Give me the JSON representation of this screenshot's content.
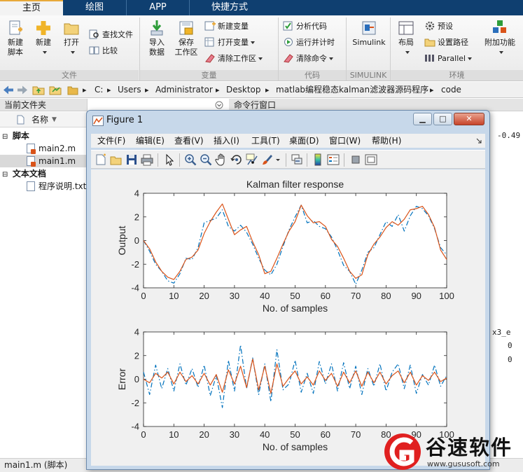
{
  "ribbon_tabs": [
    "主页",
    "绘图",
    "APP",
    "快捷方式"
  ],
  "ribbon": {
    "file_group": {
      "label": "文件",
      "new_script": "新建\n脚本",
      "new": "新建",
      "open": "打开",
      "find_files": "查找文件",
      "compare": "比较"
    },
    "variable_group": {
      "label": "变量",
      "import_data": "导入\n数据",
      "save_workspace": "保存\n工作区",
      "new_variable": "新建变量",
      "open_variable": "打开变量",
      "clear_workspace": "清除工作区"
    },
    "code_group": {
      "label": "代码",
      "analyze_code": "分析代码",
      "run_and_time": "运行并计时",
      "clear_commands": "清除命令"
    },
    "simulink_group": {
      "label": "SIMULINK",
      "simulink": "Simulink"
    },
    "env_group": {
      "label": "环境",
      "layout": "布局",
      "preferences": "预设",
      "set_path": "设置路径",
      "parallel": "Parallel",
      "addons": "附加功能"
    }
  },
  "address_bar": {
    "segments": [
      "C:",
      "Users",
      "Administrator",
      "Desktop",
      "matlab编程稳态kalman滤波器源码程序",
      "code"
    ]
  },
  "left_panel": {
    "title": "当前文件夹",
    "column_name": "名称",
    "sort_indicator": "▼",
    "groups": [
      {
        "label": "脚本",
        "files": [
          "main2.m",
          "main1.m"
        ]
      },
      {
        "label": "文本文档",
        "files": [
          "程序说明.txt"
        ]
      }
    ]
  },
  "right_panel": {
    "title": "命令行窗口",
    "values": [
      "-0.49",
      "x3_e",
      "0",
      "0"
    ]
  },
  "status_bar": {
    "text": "main1.m  (脚本)"
  },
  "figure": {
    "title": "Figure 1",
    "menus": [
      "文件(F)",
      "编辑(E)",
      "查看(V)",
      "插入(I)",
      "工具(T)",
      "桌面(D)",
      "窗口(W)",
      "帮助(H)"
    ],
    "toolbar_icons": [
      "new-figure-icon",
      "open-file-icon",
      "save-icon",
      "print-icon",
      "pointer-icon",
      "zoom-in-icon",
      "zoom-out-icon",
      "pan-hand-icon",
      "rotate-3d-icon",
      "data-cursor-icon",
      "brush-icon",
      "link-plot-icon",
      "colorbar-icon",
      "legend-icon",
      "hide-plot-tools-icon",
      "show-plot-tools-icon"
    ]
  },
  "watermark": {
    "brand": "谷速软件",
    "url": "www.gususoft.com"
  },
  "colors": {
    "series_blue": "#0072bd",
    "series_orange": "#d95319",
    "ribbon_tab_bg": "#0f3f70",
    "figure_frame": "#c7d8ea"
  },
  "chart_data": [
    {
      "type": "line",
      "title": "Kalman filter response",
      "xlabel": "No. of samples",
      "ylabel": "Output",
      "xlim": [
        0,
        100
      ],
      "ylim": [
        -4,
        4
      ],
      "xticks": [
        0,
        10,
        20,
        30,
        40,
        50,
        60,
        70,
        80,
        90,
        100
      ],
      "yticks": [
        -4,
        -2,
        0,
        2,
        4
      ],
      "grid": false,
      "series": [
        {
          "style": "dashdot",
          "color": "#0072bd",
          "x": [
            0,
            2,
            4,
            6,
            8,
            10,
            12,
            14,
            16,
            18,
            20,
            22,
            24,
            26,
            28,
            30,
            32,
            34,
            36,
            38,
            40,
            42,
            44,
            46,
            48,
            50,
            52,
            54,
            56,
            58,
            60,
            62,
            64,
            66,
            68,
            70,
            72,
            74,
            76,
            78,
            80,
            82,
            84,
            86,
            88,
            90,
            92,
            94,
            96,
            98,
            100
          ],
          "y": [
            0.0,
            -0.9,
            -2.0,
            -2.6,
            -3.4,
            -3.6,
            -2.8,
            -1.5,
            -1.6,
            -0.6,
            1.5,
            1.7,
            1.9,
            2.6,
            1.2,
            0.8,
            1.3,
            0.7,
            -0.3,
            -1.5,
            -2.5,
            -2.9,
            -2.0,
            -0.5,
            0.9,
            2.0,
            3.0,
            1.5,
            1.7,
            1.2,
            1.0,
            0.3,
            -0.8,
            -2.1,
            -2.6,
            -3.7,
            -2.5,
            -1.0,
            -0.6,
            0.5,
            1.6,
            1.2,
            2.2,
            0.8,
            2.1,
            2.9,
            2.7,
            2.1,
            1.0,
            -0.6,
            -1.2
          ]
        },
        {
          "style": "solid",
          "color": "#d95319",
          "x": [
            0,
            2,
            4,
            6,
            8,
            10,
            12,
            14,
            16,
            18,
            20,
            22,
            24,
            26,
            28,
            30,
            32,
            34,
            36,
            38,
            40,
            42,
            44,
            46,
            48,
            50,
            52,
            54,
            56,
            58,
            60,
            62,
            64,
            66,
            68,
            70,
            72,
            74,
            76,
            78,
            80,
            82,
            84,
            86,
            88,
            90,
            92,
            94,
            96,
            98,
            100
          ],
          "y": [
            0.0,
            -0.7,
            -1.8,
            -2.6,
            -3.1,
            -3.3,
            -2.6,
            -1.6,
            -1.4,
            -0.8,
            0.6,
            1.6,
            2.4,
            3.1,
            1.8,
            0.5,
            0.9,
            1.2,
            -0.1,
            -1.2,
            -2.8,
            -2.6,
            -1.5,
            -0.3,
            0.8,
            1.6,
            3.0,
            2.1,
            1.5,
            1.6,
            1.2,
            0.1,
            -0.5,
            -1.5,
            -2.6,
            -3.2,
            -2.9,
            -1.2,
            -0.3,
            0.3,
            1.1,
            1.6,
            1.3,
            1.8,
            2.6,
            2.7,
            2.9,
            2.2,
            1.1,
            -0.8,
            -1.6
          ]
        }
      ]
    },
    {
      "type": "line",
      "title": "",
      "xlabel": "No. of samples",
      "ylabel": "Error",
      "xlim": [
        0,
        100
      ],
      "ylim": [
        -4,
        4
      ],
      "xticks": [
        0,
        10,
        20,
        30,
        40,
        50,
        60,
        70,
        80,
        90,
        100
      ],
      "yticks": [
        -4,
        -2,
        0,
        2,
        4
      ],
      "grid": false,
      "series": [
        {
          "style": "dashdot",
          "color": "#0072bd",
          "x": [
            0,
            2,
            4,
            6,
            8,
            10,
            12,
            14,
            16,
            18,
            20,
            22,
            24,
            26,
            28,
            30,
            32,
            34,
            36,
            38,
            40,
            42,
            44,
            46,
            48,
            50,
            52,
            54,
            56,
            58,
            60,
            62,
            64,
            66,
            68,
            70,
            72,
            74,
            76,
            78,
            80,
            82,
            84,
            86,
            88,
            90,
            92,
            94,
            96,
            98,
            100
          ],
          "y": [
            0.6,
            -1.3,
            1.2,
            -0.8,
            0.9,
            -1.0,
            1.3,
            -0.5,
            0.9,
            -0.7,
            1.2,
            -1.4,
            0.3,
            -2.4,
            1.6,
            -1.0,
            2.9,
            -0.8,
            1.8,
            -1.3,
            1.3,
            -1.9,
            2.5,
            -0.9,
            -0.4,
            1.6,
            -1.1,
            0.5,
            -1.2,
            1.5,
            -0.4,
            1.3,
            -1.0,
            1.4,
            -0.8,
            1.1,
            -1.3,
            0.9,
            -0.6,
            1.3,
            -1.0,
            0.6,
            1.3,
            -0.8,
            1.2,
            -1.2,
            0.4,
            -0.5,
            1.2,
            -0.6,
            0.3
          ]
        },
        {
          "style": "solid",
          "color": "#d95319",
          "x": [
            0,
            2,
            4,
            6,
            8,
            10,
            12,
            14,
            16,
            18,
            20,
            22,
            24,
            26,
            28,
            30,
            32,
            34,
            36,
            38,
            40,
            42,
            44,
            46,
            48,
            50,
            52,
            54,
            56,
            58,
            60,
            62,
            64,
            66,
            68,
            70,
            72,
            74,
            76,
            78,
            80,
            82,
            84,
            86,
            88,
            90,
            92,
            94,
            96,
            98,
            100
          ],
          "y": [
            0.0,
            -0.3,
            0.5,
            0.1,
            0.6,
            -0.4,
            0.6,
            -0.2,
            0.3,
            -0.4,
            0.5,
            -0.5,
            0.4,
            -1.1,
            0.8,
            -0.4,
            1.1,
            -0.7,
            1.7,
            -0.9,
            1.1,
            -1.2,
            1.3,
            -0.6,
            0.1,
            0.7,
            -0.4,
            0.2,
            -0.5,
            0.7,
            -0.1,
            0.5,
            -0.6,
            0.6,
            -0.3,
            0.7,
            -0.6,
            0.6,
            -0.3,
            0.6,
            -0.4,
            0.3,
            0.7,
            -0.3,
            0.6,
            -0.5,
            0.3,
            -0.1,
            0.6,
            -0.2,
            0.1
          ]
        }
      ]
    }
  ]
}
